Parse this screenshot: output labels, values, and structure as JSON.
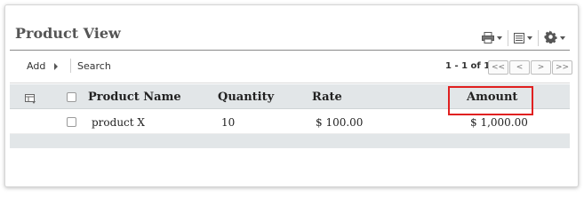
{
  "panel": {
    "title": "Product View"
  },
  "top_tools": {
    "print_icon": "printer-icon",
    "view_icon": "list-view-icon",
    "settings_icon": "gear-icon"
  },
  "toolbar": {
    "add_label": "Add",
    "search_label": "Search",
    "pager_info": "1 - 1 of 1",
    "pager_buttons": [
      "<<",
      "<",
      ">",
      ">>"
    ]
  },
  "table": {
    "columns": [
      "Product Name",
      "Quantity",
      "Rate",
      "Amount"
    ],
    "rows": [
      {
        "product_name": "product X",
        "quantity": "10",
        "rate": "$ 100.00",
        "amount": "$ 1,000.00"
      }
    ]
  },
  "colors": {
    "header_bg": "#e2e6e8",
    "highlight": "#e02020"
  }
}
